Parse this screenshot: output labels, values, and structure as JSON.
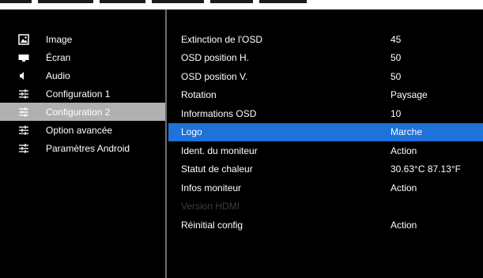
{
  "left_menu": {
    "items": [
      {
        "label": "Image",
        "icon": "image-icon",
        "selected": false
      },
      {
        "label": "Écran",
        "icon": "screen-icon",
        "selected": false
      },
      {
        "label": "Audio",
        "icon": "speaker-icon",
        "selected": false
      },
      {
        "label": "Configuration 1",
        "icon": "sliders-icon",
        "selected": false
      },
      {
        "label": "Configuration 2",
        "icon": "sliders-icon",
        "selected": true
      },
      {
        "label": "Option avancée",
        "icon": "sliders-icon",
        "selected": false
      },
      {
        "label": "Paramètres Android",
        "icon": "sliders-icon",
        "selected": false
      }
    ]
  },
  "settings": {
    "rows": [
      {
        "label": "Extinction de l'OSD",
        "value": "45"
      },
      {
        "label": "OSD position H.",
        "value": "50"
      },
      {
        "label": "OSD position V.",
        "value": "50"
      },
      {
        "label": "Rotation",
        "value": "Paysage"
      },
      {
        "label": "Informations OSD",
        "value": "10"
      },
      {
        "label": "Logo",
        "value": "Marche",
        "highlighted": true
      },
      {
        "label": "Ident. du moniteur",
        "value": "Action"
      },
      {
        "label": "Statut de chaleur",
        "value": "30.63°C 87.13°F"
      },
      {
        "label": "Infos moniteur",
        "value": "Action"
      },
      {
        "label": "Version HDMI",
        "value": "",
        "disabled": true
      },
      {
        "label": "Réinitial config",
        "value": "Action"
      }
    ]
  },
  "colors": {
    "background": "#000000",
    "selected_menu": "#b0b0b0",
    "highlight_row": "#1e72d9",
    "divider": "#6b6b6b",
    "disabled_text": "#3d3d3d"
  }
}
